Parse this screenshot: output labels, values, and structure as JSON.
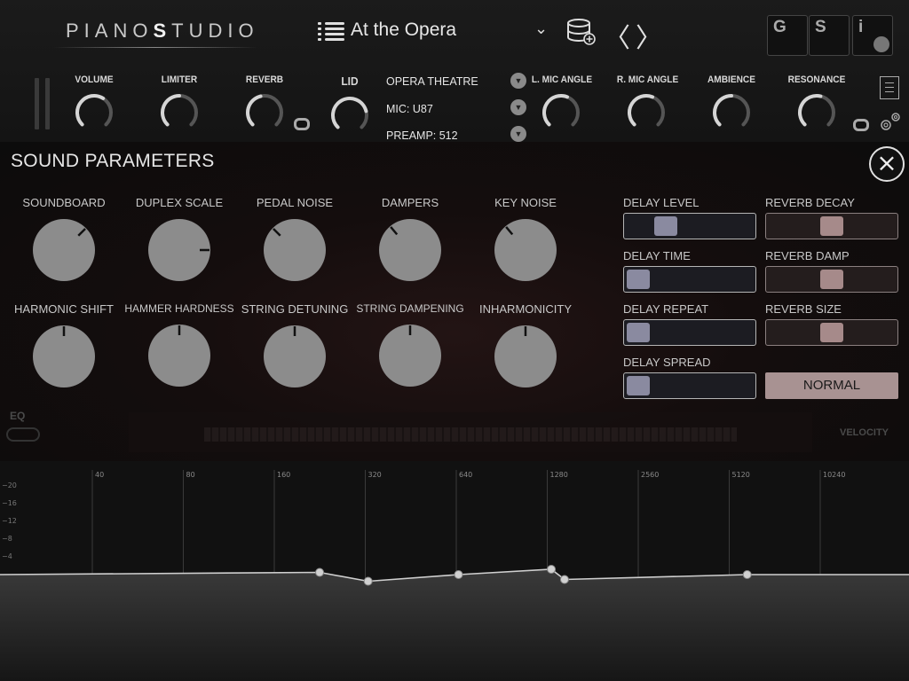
{
  "header": {
    "logo_left": "PIANO",
    "logo_bold": "S",
    "logo_right": "TUDIO",
    "preset_name": "At the Opera",
    "buttons": {
      "g": "G",
      "s": "S",
      "i": "i"
    },
    "knobs": [
      {
        "label": "VOLUME",
        "value": 0.62
      },
      {
        "label": "LIMITER",
        "value": 0.5
      },
      {
        "label": "REVERB",
        "value": 0.45
      },
      {
        "label": "LID",
        "value": 0.78
      },
      {
        "label": "L. MIC ANGLE",
        "value": 0.58
      },
      {
        "label": "R. MIC ANGLE",
        "value": 0.58
      },
      {
        "label": "AMBIENCE",
        "value": 0.5
      },
      {
        "label": "RESONANCE",
        "value": 0.55
      }
    ],
    "room": "OPERA THEATRE",
    "mic": "MIC: U87",
    "preamp": "PREAMP: 512"
  },
  "panel": {
    "title": "SOUND PARAMETERS",
    "close": "×",
    "knobs_row1": [
      {
        "label": "SOUNDBOARD",
        "angle": 45
      },
      {
        "label": "DUPLEX SCALE",
        "angle": 90
      },
      {
        "label": "PEDAL NOISE",
        "angle": -45
      },
      {
        "label": "DAMPERS",
        "angle": -40
      },
      {
        "label": "KEY NOISE",
        "angle": -40
      }
    ],
    "knobs_row2": [
      {
        "label": "HARMONIC SHIFT",
        "angle": 0
      },
      {
        "label": "HAMMER HARDNESS",
        "angle": 0
      },
      {
        "label": "STRING DETUNING",
        "angle": 0
      },
      {
        "label": "STRING DAMPENING",
        "angle": 0
      },
      {
        "label": "INHARMONICITY",
        "angle": 0
      }
    ],
    "delay_sliders": [
      {
        "label": "DELAY LEVEL",
        "value": 0.27
      },
      {
        "label": "DELAY TIME",
        "value": 0.0
      },
      {
        "label": "DELAY REPEAT",
        "value": 0.0
      },
      {
        "label": "DELAY SPREAD",
        "value": 0.0
      }
    ],
    "reverb_sliders": [
      {
        "label": "REVERB DECAY",
        "value": 0.5
      },
      {
        "label": "REVERB DAMP",
        "value": 0.5
      },
      {
        "label": "REVERB SIZE",
        "value": 0.5
      }
    ],
    "mode_button": "NORMAL",
    "bg_eq": "EQ",
    "bg_velocity": "VELOCITY"
  },
  "eq": {
    "freqs": [
      "40",
      "80",
      "160",
      "320",
      "640",
      "1280",
      "2560",
      "5120",
      "10240"
    ],
    "db_labels": [
      "20",
      "16",
      "12",
      "8",
      "4"
    ],
    "points": [
      {
        "freq": 226,
        "gain": 0.5
      },
      {
        "freq": 327,
        "gain": -1.5
      },
      {
        "freq": 651,
        "gain": 0.0
      },
      {
        "freq": 1320,
        "gain": 1.2
      },
      {
        "freq": 1460,
        "gain": -1.1
      },
      {
        "freq": 5870,
        "gain": 0.0
      }
    ]
  }
}
